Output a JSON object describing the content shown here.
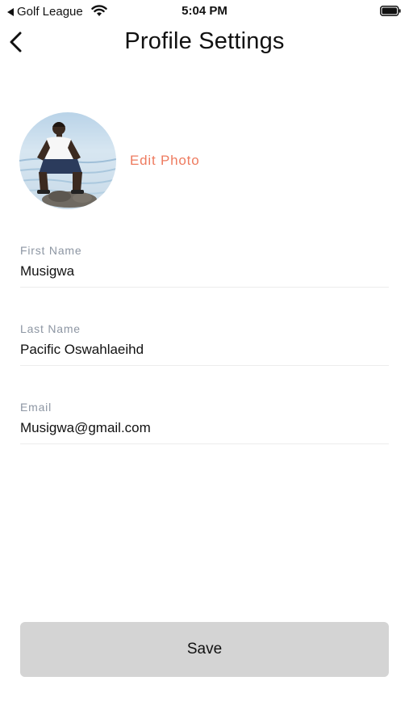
{
  "status_bar": {
    "back_app": "Golf League",
    "time": "5:04 PM"
  },
  "nav": {
    "title": "Profile Settings"
  },
  "profile": {
    "avatar_alt": "profile-photo",
    "edit_photo_label": "Edit Photo"
  },
  "fields": {
    "first_name": {
      "label": "First Name",
      "value": "Musigwa"
    },
    "last_name": {
      "label": "Last Name",
      "value": "Pacific Oswahlaeihd"
    },
    "email": {
      "label": "Email",
      "value": "Musigwa@gmail.com"
    }
  },
  "actions": {
    "save_label": "Save"
  },
  "colors": {
    "accent": "#ee7b5f",
    "label_gray": "#8d96a3",
    "button_bg": "#d4d4d4"
  }
}
